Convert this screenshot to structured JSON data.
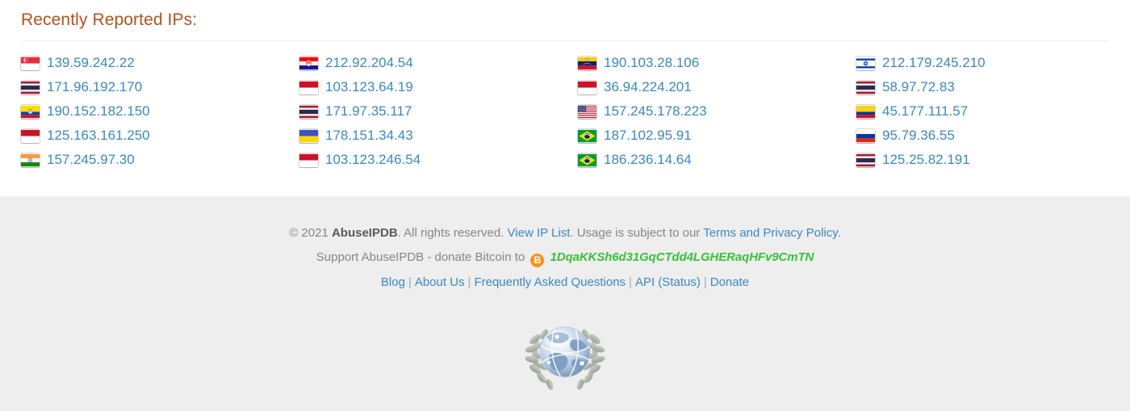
{
  "section": {
    "title": "Recently Reported IPs:"
  },
  "colors": {
    "heading": "#b5521a",
    "link": "#3b88c3",
    "footer_bg": "#eeeeee",
    "footer_text": "#868686",
    "bitcoin_accent": "#f7931a",
    "bitcoin_address": "#3ac13a"
  },
  "ips": [
    {
      "address": "139.59.242.22",
      "country": "Singapore",
      "flag": "sg"
    },
    {
      "address": "212.92.204.54",
      "country": "Croatia",
      "flag": "hr"
    },
    {
      "address": "190.103.28.106",
      "country": "Venezuela",
      "flag": "ve"
    },
    {
      "address": "212.179.245.210",
      "country": "Israel",
      "flag": "il"
    },
    {
      "address": "171.96.192.170",
      "country": "Thailand",
      "flag": "th"
    },
    {
      "address": "103.123.64.19",
      "country": "Indonesia",
      "flag": "id"
    },
    {
      "address": "36.94.224.201",
      "country": "Indonesia",
      "flag": "id"
    },
    {
      "address": "58.97.72.83",
      "country": "Thailand",
      "flag": "th"
    },
    {
      "address": "190.152.182.150",
      "country": "Ecuador",
      "flag": "ec"
    },
    {
      "address": "171.97.35.117",
      "country": "Thailand",
      "flag": "th"
    },
    {
      "address": "157.245.178.223",
      "country": "United States",
      "flag": "us"
    },
    {
      "address": "45.177.111.57",
      "country": "Colombia",
      "flag": "co"
    },
    {
      "address": "125.163.161.250",
      "country": "Indonesia",
      "flag": "id"
    },
    {
      "address": "178.151.34.43",
      "country": "Ukraine",
      "flag": "ua"
    },
    {
      "address": "187.102.95.91",
      "country": "Brazil",
      "flag": "br"
    },
    {
      "address": "95.79.36.55",
      "country": "Russia",
      "flag": "ru"
    },
    {
      "address": "157.245.97.30",
      "country": "India",
      "flag": "in"
    },
    {
      "address": "103.123.246.54",
      "country": "Indonesia",
      "flag": "id"
    },
    {
      "address": "186.236.14.64",
      "country": "Brazil",
      "flag": "br"
    },
    {
      "address": "125.25.82.191",
      "country": "Thailand",
      "flag": "th"
    }
  ],
  "footer": {
    "copyright_prefix": "© 2021 ",
    "brand": "AbuseIPDB",
    "copyright_middle": ". All rights reserved. ",
    "view_ip_list": "View IP List",
    "usage_text": ". Usage is subject to our ",
    "terms_link": "Terms and Privacy Policy",
    "terms_suffix": ".",
    "donate_text": "Support AbuseIPDB - donate Bitcoin to",
    "bitcoin_icon_glyph": "Ƀ",
    "bitcoin_address": "1DqaKKSh6d31GqCTdd4LGHERaqHFv9CmTN",
    "nav": [
      {
        "label": "Blog"
      },
      {
        "label": "About Us"
      },
      {
        "label": "Frequently Asked Questions"
      },
      {
        "label": "API"
      },
      {
        "label": "(Status)"
      },
      {
        "label": "Donate"
      }
    ],
    "nav_separator": "|"
  }
}
